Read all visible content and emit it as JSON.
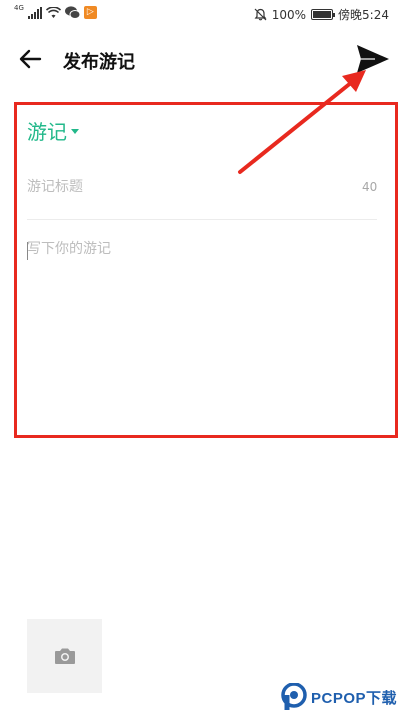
{
  "status_bar": {
    "signal_label": "4G",
    "battery_text": "100%",
    "battery_level": 1.0,
    "carrier_time": "傍晚5:24"
  },
  "header": {
    "title": "发布游记",
    "back_icon": "arrow-left-icon",
    "send_icon": "send-paper-plane-icon"
  },
  "editor": {
    "category_label": "游记",
    "title_placeholder": "游记标题",
    "title_max_chars": "40",
    "body_placeholder": "写下你的游记"
  },
  "attachments": {
    "add_photo_icon": "camera-icon"
  },
  "watermark": {
    "text": "PCPOP下载"
  },
  "colors": {
    "accent": "#22b88a",
    "annotation": "#e8291f",
    "watermark": "#1f5fae"
  }
}
